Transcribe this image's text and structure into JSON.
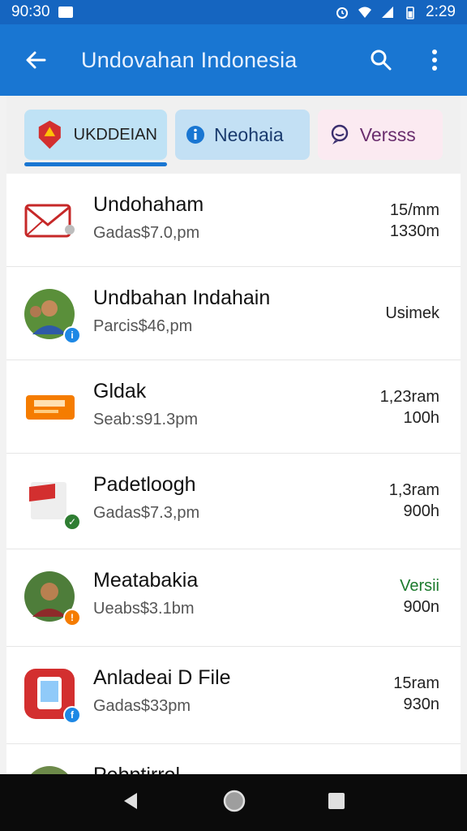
{
  "status_bar": {
    "time_left": "90:30",
    "time_right": "2:29"
  },
  "app_bar": {
    "title": "Undovahan Indonesia",
    "back_icon": "arrow-left-icon",
    "search_icon": "search-icon",
    "more_icon": "more-vert-icon"
  },
  "tabs": [
    {
      "label": "UKDDEIAN",
      "icon": "emblem-icon",
      "selected": true
    },
    {
      "label": "Neohaia",
      "icon": "info-circle-icon",
      "selected": false
    },
    {
      "label": "Versss",
      "icon": "chat-icon",
      "selected": false
    }
  ],
  "rows": [
    {
      "name": "Undohaham",
      "sub": "Gadas$7.0,pm",
      "meta1": "15/mm",
      "meta2": "1330m",
      "avatar": "mail-icon"
    },
    {
      "name": "Undbahan Indahain",
      "sub": "Parcis$46,pm",
      "meta1": "Usimek",
      "meta2": "",
      "avatar": "person-photo"
    },
    {
      "name": "Gldak",
      "sub": "Seab:s91.3pm",
      "meta1": "1,23ram",
      "meta2": "100h",
      "avatar": "ticket-icon"
    },
    {
      "name": "Padetloogh",
      "sub": "Gadas$7.3,pm",
      "meta1": "1,3ram",
      "meta2": "900h",
      "avatar": "flag-icon"
    },
    {
      "name": "Meatabakia",
      "sub": "Ueabs$3.1bm",
      "meta1": "Versii",
      "meta2": "900n",
      "avatar": "person-photo"
    },
    {
      "name": "Anladeai D File",
      "sub": "Gadas$33pm",
      "meta1": "15ram",
      "meta2": "930n",
      "avatar": "phone-icon"
    },
    {
      "name": "Pebptirrol",
      "sub": "",
      "meta1": "",
      "meta2": "",
      "avatar": "person-photo"
    }
  ],
  "colors": {
    "primary": "#1976d2",
    "status": "#1565c0",
    "accent_green": "#1b7a2c"
  }
}
